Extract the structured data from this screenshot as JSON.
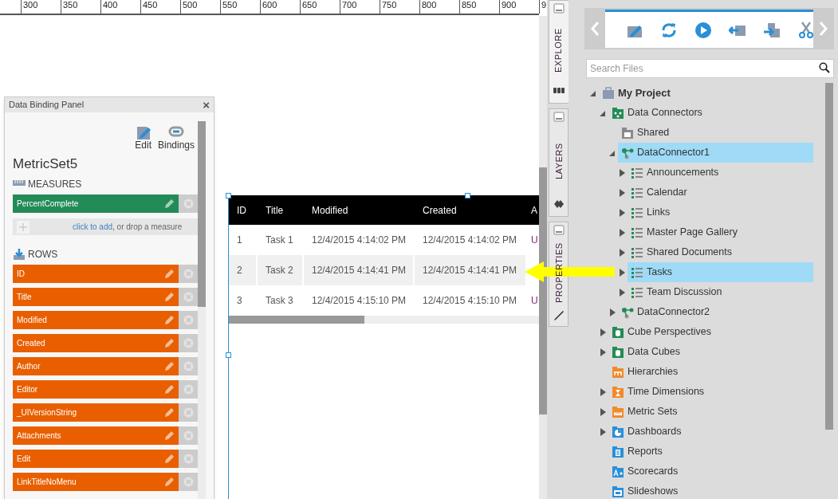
{
  "ruler": [
    "300",
    "350",
    "400",
    "450",
    "500",
    "550",
    "600",
    "650",
    "700",
    "750",
    "800",
    "850",
    "900",
    "9"
  ],
  "binding_panel": {
    "title": "Data Binding Panel",
    "close": "×",
    "actions": [
      {
        "label": "Edit",
        "kind": "edit"
      },
      {
        "label": "Bindings",
        "kind": "bindings"
      }
    ],
    "metric_set": "MetricSet5",
    "measures": {
      "heading": "MEASURES",
      "items": [
        "PercentComplete"
      ],
      "add_link": "click to add",
      "add_hint": ", or drop a measure"
    },
    "rows": {
      "heading": "ROWS",
      "items": [
        "ID",
        "Title",
        "Modified",
        "Created",
        "Author",
        "Editor",
        "_UIVersionString",
        "Attachments",
        "Edit",
        "LinkTitleNoMenu"
      ]
    }
  },
  "table": {
    "columns": [
      "ID",
      "Title",
      "Modified",
      "Created",
      "A"
    ],
    "rows": [
      {
        "selected": false,
        "cells": [
          "1",
          "Task 1",
          "12/4/2015 4:14:02 PM",
          "12/4/2015 4:14:02 PM",
          "U"
        ]
      },
      {
        "selected": true,
        "cells": [
          "2",
          "Task 2",
          "12/4/2015 4:14:41 PM",
          "12/4/2015 4:14:41 PM"
        ]
      },
      {
        "selected": false,
        "cells": [
          "3",
          "Task 3",
          "12/4/2015 4:15:10 PM",
          "12/4/2015 4:15:10 PM",
          "U"
        ]
      }
    ]
  },
  "side_tabs": [
    {
      "label": "EXPLORE",
      "kind": "explore",
      "selected": true
    },
    {
      "label": "LAYERS",
      "kind": "layers",
      "selected": false
    },
    {
      "label": "PROPERTIES",
      "kind": "properties",
      "selected": false
    }
  ],
  "search": {
    "placeholder": "Search Files"
  },
  "tree": [
    {
      "label": "My Project",
      "kind": "project",
      "expanded": true,
      "selected": false,
      "children": [
        {
          "label": "Data Connectors",
          "kind": "connectors",
          "expanded": true,
          "selected": false,
          "children": [
            {
              "label": "Shared",
              "kind": "shared",
              "selected": false
            },
            {
              "label": "DataConnector1",
              "kind": "connector",
              "expanded": true,
              "selected": true,
              "children": [
                {
                  "label": "Announcements",
                  "kind": "list",
                  "expanded": false,
                  "selected": false
                },
                {
                  "label": "Calendar",
                  "kind": "list",
                  "expanded": false,
                  "selected": false
                },
                {
                  "label": "Links",
                  "kind": "list",
                  "expanded": false,
                  "selected": false
                },
                {
                  "label": "Master Page Gallery",
                  "kind": "list",
                  "expanded": false,
                  "selected": false
                },
                {
                  "label": "Shared Documents",
                  "kind": "list",
                  "expanded": false,
                  "selected": false
                },
                {
                  "label": "Tasks",
                  "kind": "list",
                  "expanded": false,
                  "selected": true
                },
                {
                  "label": "Team Discussion",
                  "kind": "list",
                  "expanded": false,
                  "selected": false
                }
              ]
            },
            {
              "label": "DataConnector2",
              "kind": "connector",
              "expanded": false,
              "selected": false
            }
          ]
        },
        {
          "label": "Cube Perspectives",
          "kind": "cube",
          "expanded": false,
          "selected": false
        },
        {
          "label": "Data Cubes",
          "kind": "cube",
          "expanded": false,
          "selected": false
        },
        {
          "label": "Hierarchies",
          "kind": "hierarchy",
          "selected": false
        },
        {
          "label": "Time Dimensions",
          "kind": "time",
          "expanded": false,
          "selected": false
        },
        {
          "label": "Metric Sets",
          "kind": "metric",
          "expanded": false,
          "selected": false
        },
        {
          "label": "Dashboards",
          "kind": "dashboard",
          "expanded": false,
          "selected": false
        },
        {
          "label": "Reports",
          "kind": "report",
          "selected": false
        },
        {
          "label": "Scorecards",
          "kind": "scorecard",
          "selected": false
        },
        {
          "label": "Slideshows",
          "kind": "slideshow",
          "selected": false
        }
      ]
    }
  ]
}
